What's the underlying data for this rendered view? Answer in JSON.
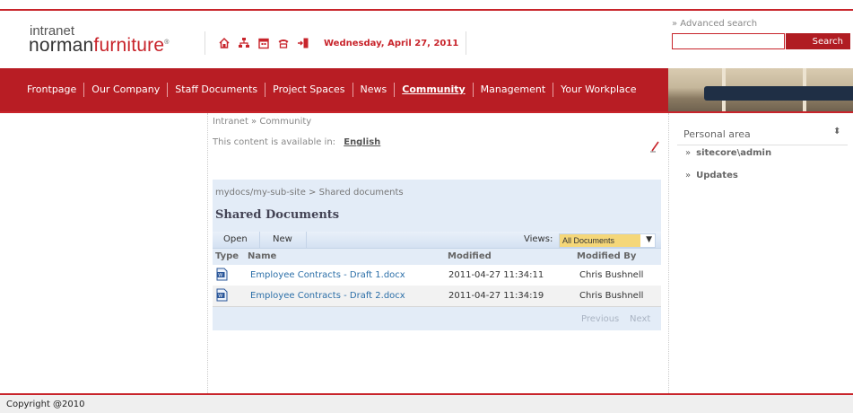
{
  "header": {
    "logo_small": "intranet",
    "logo_main_a": "norman",
    "logo_main_b": "furniture",
    "logo_mark": "®",
    "tool_icons": [
      "home-icon",
      "sitemap-icon",
      "calendar-icon",
      "phone-icon",
      "logout-icon"
    ],
    "date": "Wednesday, April 27, 2011",
    "advanced_search": "» Advanced search",
    "search_value": "",
    "search_button": "Search"
  },
  "nav": {
    "items": [
      {
        "label": "Frontpage"
      },
      {
        "label": "Our Company"
      },
      {
        "label": "Staff Documents"
      },
      {
        "label": "Project Spaces"
      },
      {
        "label": "News"
      },
      {
        "label": "Community",
        "active": true
      },
      {
        "label": "Management"
      },
      {
        "label": "Your Workplace"
      }
    ]
  },
  "content": {
    "breadcrumb": "Intranet » Community",
    "available_in": "This content is available in:",
    "language": "English",
    "library": {
      "path": "mydocs/my-sub-site > Shared documents",
      "title": "Shared Documents",
      "open_label": "Open",
      "new_label": "New",
      "views_label": "Views:",
      "views_value": "All Documents",
      "columns": {
        "type": "Type",
        "name": "Name",
        "modified": "Modified",
        "modified_by": "Modified By"
      },
      "rows": [
        {
          "name": "Employee Contracts - Draft 1.docx",
          "modified": "2011-04-27 11:34:11",
          "modified_by": "Chris Bushnell"
        },
        {
          "name": "Employee Contracts - Draft 2.docx",
          "modified": "2011-04-27 11:34:19",
          "modified_by": "Chris Bushnell"
        }
      ],
      "previous": "Previous",
      "next": "Next"
    }
  },
  "sidebar_right": {
    "title": "Personal area",
    "items": [
      {
        "label": "sitecore\\admin"
      },
      {
        "label": "Updates"
      }
    ]
  },
  "footer": {
    "copyright": "Copyright @2010"
  },
  "colors": {
    "brand_red": "#b81d24",
    "library_bg": "#e3ecf7",
    "link_blue": "#2c6fa8",
    "views_highlight": "#f5d779"
  }
}
